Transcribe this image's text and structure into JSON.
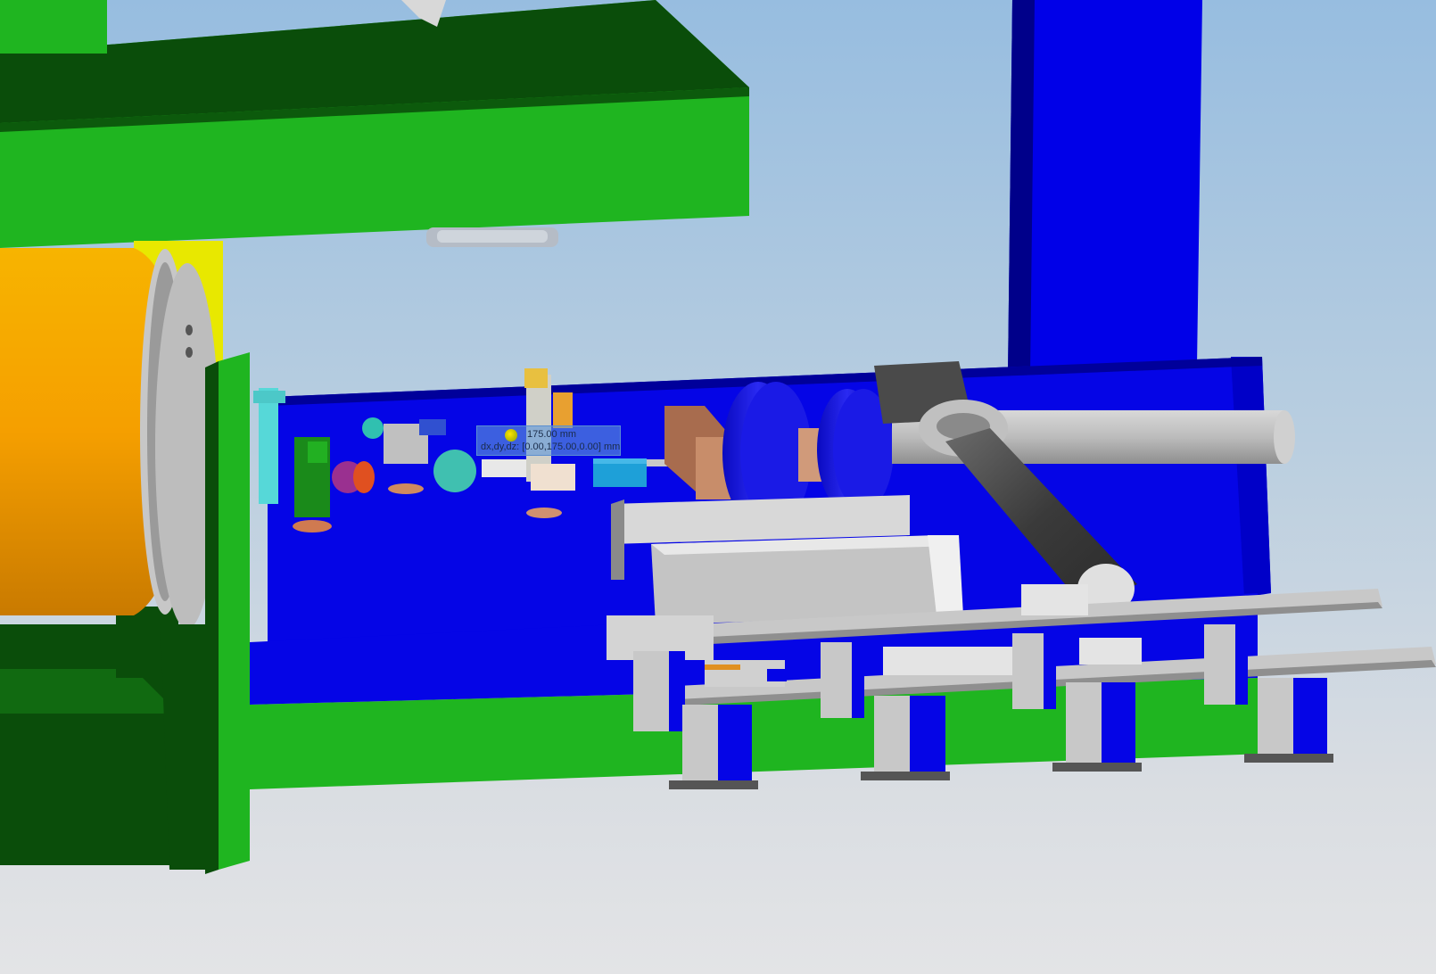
{
  "viewport": {
    "background_colors": [
      "#97bde0",
      "#d9dde2"
    ]
  },
  "scene": {
    "components": {
      "top_frame_color": "#1fb520",
      "dark_green_color": "#0a4d0a",
      "blue_plate_color": "#0505e6",
      "orange_cylinder_color": "#f2a800",
      "rail_color": "#c8c8c8",
      "blue_ring_color": "#1a1ae6",
      "copper_block_color": "#c88d6a",
      "grey_tube_color": "#bcbcbc"
    }
  },
  "measure": {
    "distance_text": "175.00 mm",
    "delta_text": "dx,dy,dz: [0.00,175.00,0.00] mm"
  }
}
